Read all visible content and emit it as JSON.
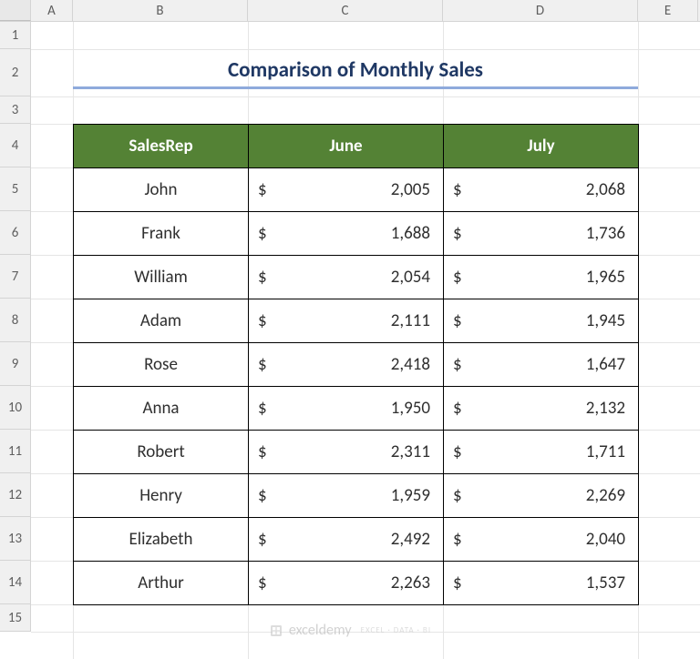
{
  "columns": [
    "A",
    "B",
    "C",
    "D",
    "E"
  ],
  "rowNumbers": [
    "1",
    "2",
    "3",
    "4",
    "5",
    "6",
    "7",
    "8",
    "9",
    "10",
    "11",
    "12",
    "13",
    "14",
    "15"
  ],
  "title": "Comparison of Monthly Sales",
  "headers": {
    "salesRep": "SalesRep",
    "june": "June",
    "july": "July"
  },
  "currency": "$",
  "rows": [
    {
      "name": "John",
      "june": "2,005",
      "july": "2,068"
    },
    {
      "name": "Frank",
      "june": "1,688",
      "july": "1,736"
    },
    {
      "name": "William",
      "june": "2,054",
      "july": "1,965"
    },
    {
      "name": "Adam",
      "june": "2,111",
      "july": "1,945"
    },
    {
      "name": "Rose",
      "june": "2,418",
      "july": "1,647"
    },
    {
      "name": "Anna",
      "june": "1,950",
      "july": "2,132"
    },
    {
      "name": "Robert",
      "june": "2,311",
      "july": "1,711"
    },
    {
      "name": "Henry",
      "june": "1,959",
      "july": "2,269"
    },
    {
      "name": "Elizabeth",
      "june": "2,492",
      "july": "2,040"
    },
    {
      "name": "Arthur",
      "june": "2,263",
      "july": "1,537"
    }
  ],
  "watermark": {
    "brand": "exceldemy",
    "tag": "EXCEL · DATA · BI"
  }
}
